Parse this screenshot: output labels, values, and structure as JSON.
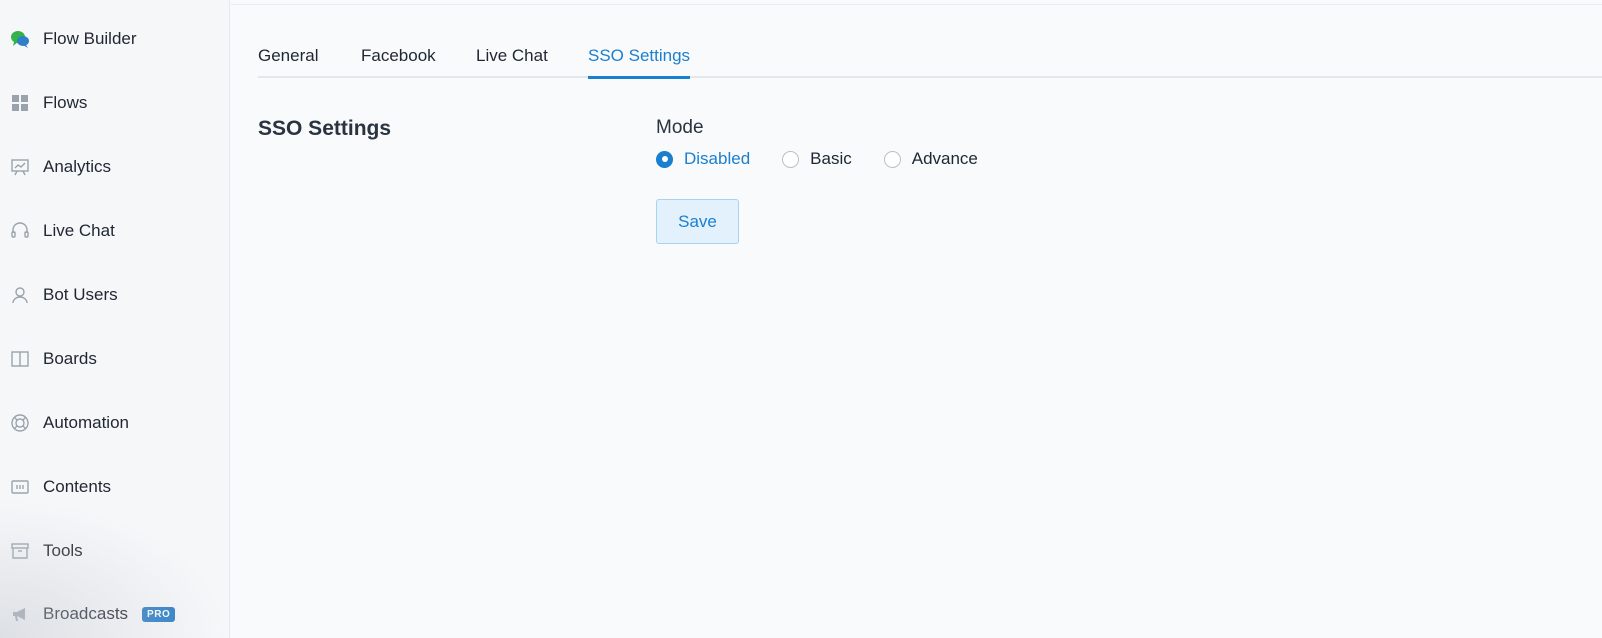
{
  "sidebar": {
    "items": [
      {
        "label": "Flow Builder",
        "icon": "chat-bubbles-icon"
      },
      {
        "label": "Flows",
        "icon": "grid-icon"
      },
      {
        "label": "Analytics",
        "icon": "presentation-chart-icon"
      },
      {
        "label": "Live Chat",
        "icon": "headset-icon"
      },
      {
        "label": "Bot Users",
        "icon": "user-icon"
      },
      {
        "label": "Boards",
        "icon": "columns-icon"
      },
      {
        "label": "Automation",
        "icon": "lifebuoy-icon"
      },
      {
        "label": "Contents",
        "icon": "content-box-icon"
      },
      {
        "label": "Tools",
        "icon": "archive-box-icon"
      },
      {
        "label": "Broadcasts",
        "icon": "megaphone-icon",
        "badge": "PRO"
      }
    ]
  },
  "tabs": [
    {
      "label": "General",
      "active": false
    },
    {
      "label": "Facebook",
      "active": false
    },
    {
      "label": "Live Chat",
      "active": false
    },
    {
      "label": "SSO Settings",
      "active": true
    }
  ],
  "section": {
    "title": "SSO Settings"
  },
  "mode": {
    "label": "Mode",
    "options": [
      "Disabled",
      "Basic",
      "Advance"
    ],
    "selected": "Disabled"
  },
  "save_label": "Save",
  "colors": {
    "accent": "#1a7fcf",
    "badge": "#2d7fc6",
    "flow_builder_green": "#34b34a"
  }
}
